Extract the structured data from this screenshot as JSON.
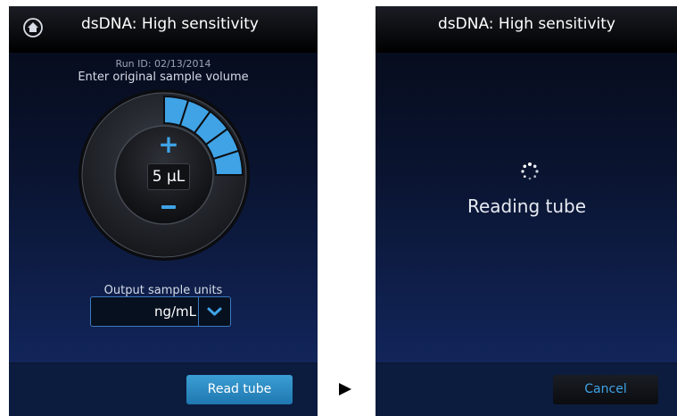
{
  "left_screen": {
    "header": {
      "title": "dsDNA: High sensitivity"
    },
    "run_id": "Run ID: 02/13/2014",
    "prompt": "Enter original sample volume",
    "volume": {
      "value": "5 µL",
      "segments_filled": 5
    },
    "units_label": "Output sample units",
    "units_select": {
      "value": "ng/mL"
    },
    "read_button": "Read tube"
  },
  "right_screen": {
    "header": {
      "title": "dsDNA: High sensitivity"
    },
    "status": "Reading tube",
    "cancel_button": "Cancel"
  },
  "colors": {
    "accent": "#3fa3e6",
    "button": "#2a8ac6",
    "background_dark": "#050a17",
    "background_mid": "#142a66"
  },
  "icons": {
    "home": "home-icon",
    "spinner": "loading-spinner-icon",
    "chevron": "chevron-down-icon",
    "arrow": "play-arrow-icon"
  }
}
